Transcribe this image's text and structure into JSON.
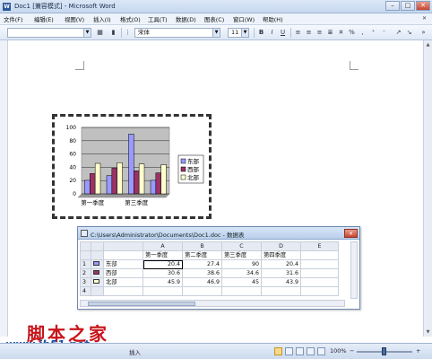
{
  "window": {
    "title": "Doc1 [兼容模式] - Microsoft Word",
    "app_icon": "W",
    "buttons": [
      "–",
      "□",
      "✕"
    ]
  },
  "menu": {
    "items": [
      "文件(F)",
      "编辑(E)",
      "视图(V)",
      "插入(I)",
      "格式(O)",
      "工具(T)",
      "数据(D)",
      "图表(C)",
      "窗口(W)",
      "帮助(H)"
    ],
    "help_icon": "help-icon"
  },
  "toolbar": {
    "font_name": "宋体",
    "font_size": "11",
    "bold": "B",
    "italic": "I",
    "underline": "U",
    "percent": "%",
    "comma": ","
  },
  "chart_data": {
    "type": "bar",
    "categories": [
      "第一季度",
      "第二季度",
      "第三季度",
      "第四季度"
    ],
    "x_tick_labels_shown": [
      "第一季度",
      "第三季度"
    ],
    "series": [
      {
        "name": "东部",
        "values": [
          20.4,
          27.4,
          90,
          20.4
        ],
        "color": "#9999ff"
      },
      {
        "name": "西部",
        "values": [
          30.6,
          38.6,
          34.6,
          31.6
        ],
        "color": "#993366"
      },
      {
        "name": "北部",
        "values": [
          45.9,
          46.9,
          45,
          43.9
        ],
        "color": "#ffffcc"
      }
    ],
    "y_ticks": [
      "0",
      "20",
      "40",
      "60",
      "80",
      "100"
    ],
    "ylim": [
      0,
      100
    ],
    "grid": true,
    "legend_placement": "right",
    "plot_background": "#c0c0c0"
  },
  "datasheet": {
    "title": "C:\\Users\\Administrator\\Documents\\Doc1.doc - 数据表",
    "column_letters": [
      "A",
      "B",
      "C",
      "D",
      "E"
    ],
    "header_row": [
      "第一季度",
      "第二季度",
      "第三季度",
      "第四季度",
      ""
    ],
    "rows": [
      {
        "num": "1",
        "label": "东部",
        "values": [
          "20.4",
          "27.4",
          "90",
          "20.4",
          ""
        ]
      },
      {
        "num": "2",
        "label": "西部",
        "values": [
          "30.6",
          "38.6",
          "34.6",
          "31.6",
          ""
        ]
      },
      {
        "num": "3",
        "label": "北部",
        "values": [
          "45.9",
          "46.9",
          "45",
          "43.9",
          ""
        ]
      },
      {
        "num": "4",
        "label": "",
        "values": [
          "",
          "",
          "",
          "",
          ""
        ]
      }
    ]
  },
  "watermark": {
    "text": "脚本之家",
    "url": "www.jb51.net"
  },
  "statusbar": {
    "mode": "插入",
    "zoom": "100%",
    "zoom_minus": "−",
    "zoom_plus": "+"
  }
}
